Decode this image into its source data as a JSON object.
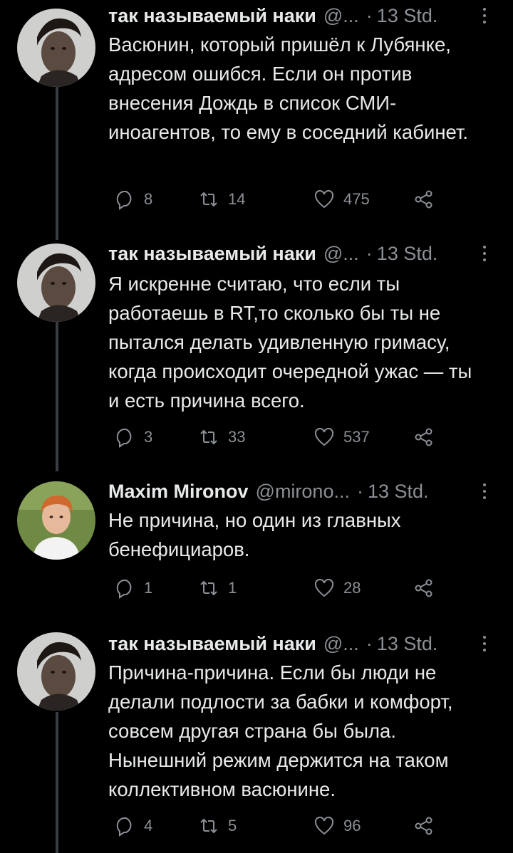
{
  "tweets": [
    {
      "author": "так называемый наки",
      "handle": "@...",
      "time": "13 Std.",
      "text": "Васюнин, который пришёл к Лубянке, адресом ошибся. Если он против внесения Дождь в список СМИ-иноагентов, то ему в соседний кабинет.",
      "replies": "8",
      "retweets": "14",
      "likes": "475"
    },
    {
      "author": "так называемый наки",
      "handle": "@...",
      "time": "13 Std.",
      "text": "Я искренне считаю, что если ты работаешь в RT,то сколько бы ты не пытался делать удивленную гримасу, когда происходит очередной ужас — ты и есть причина всего.",
      "replies": "3",
      "retweets": "33",
      "likes": "537"
    },
    {
      "author": "Maxim Mironov",
      "handle": "@mirono...",
      "time": "13 Std.",
      "text": "Не причина, но один из главных бенефициаров.",
      "replies": "1",
      "retweets": "1",
      "likes": "28"
    },
    {
      "author": "так называемый наки",
      "handle": "@...",
      "time": "13 Std.",
      "text": "Причина-причина. Если бы люди не делали подлости за бабки и комфорт, совсем другая страна бы была. Нынешний режим держится на таком коллективном васюнине.",
      "replies": "4",
      "retweets": "5",
      "likes": "96"
    }
  ],
  "separator": "·",
  "icons": {
    "reply": "speech-bubble-icon",
    "retweet": "retweet-arrows-icon",
    "like": "heart-icon",
    "share": "share-nodes-icon",
    "more": "vertical-dots-icon"
  },
  "colors": {
    "background": "#000000",
    "text": "#e7e9ea",
    "muted": "#8b9096",
    "thread_line": "#3a3d41"
  }
}
